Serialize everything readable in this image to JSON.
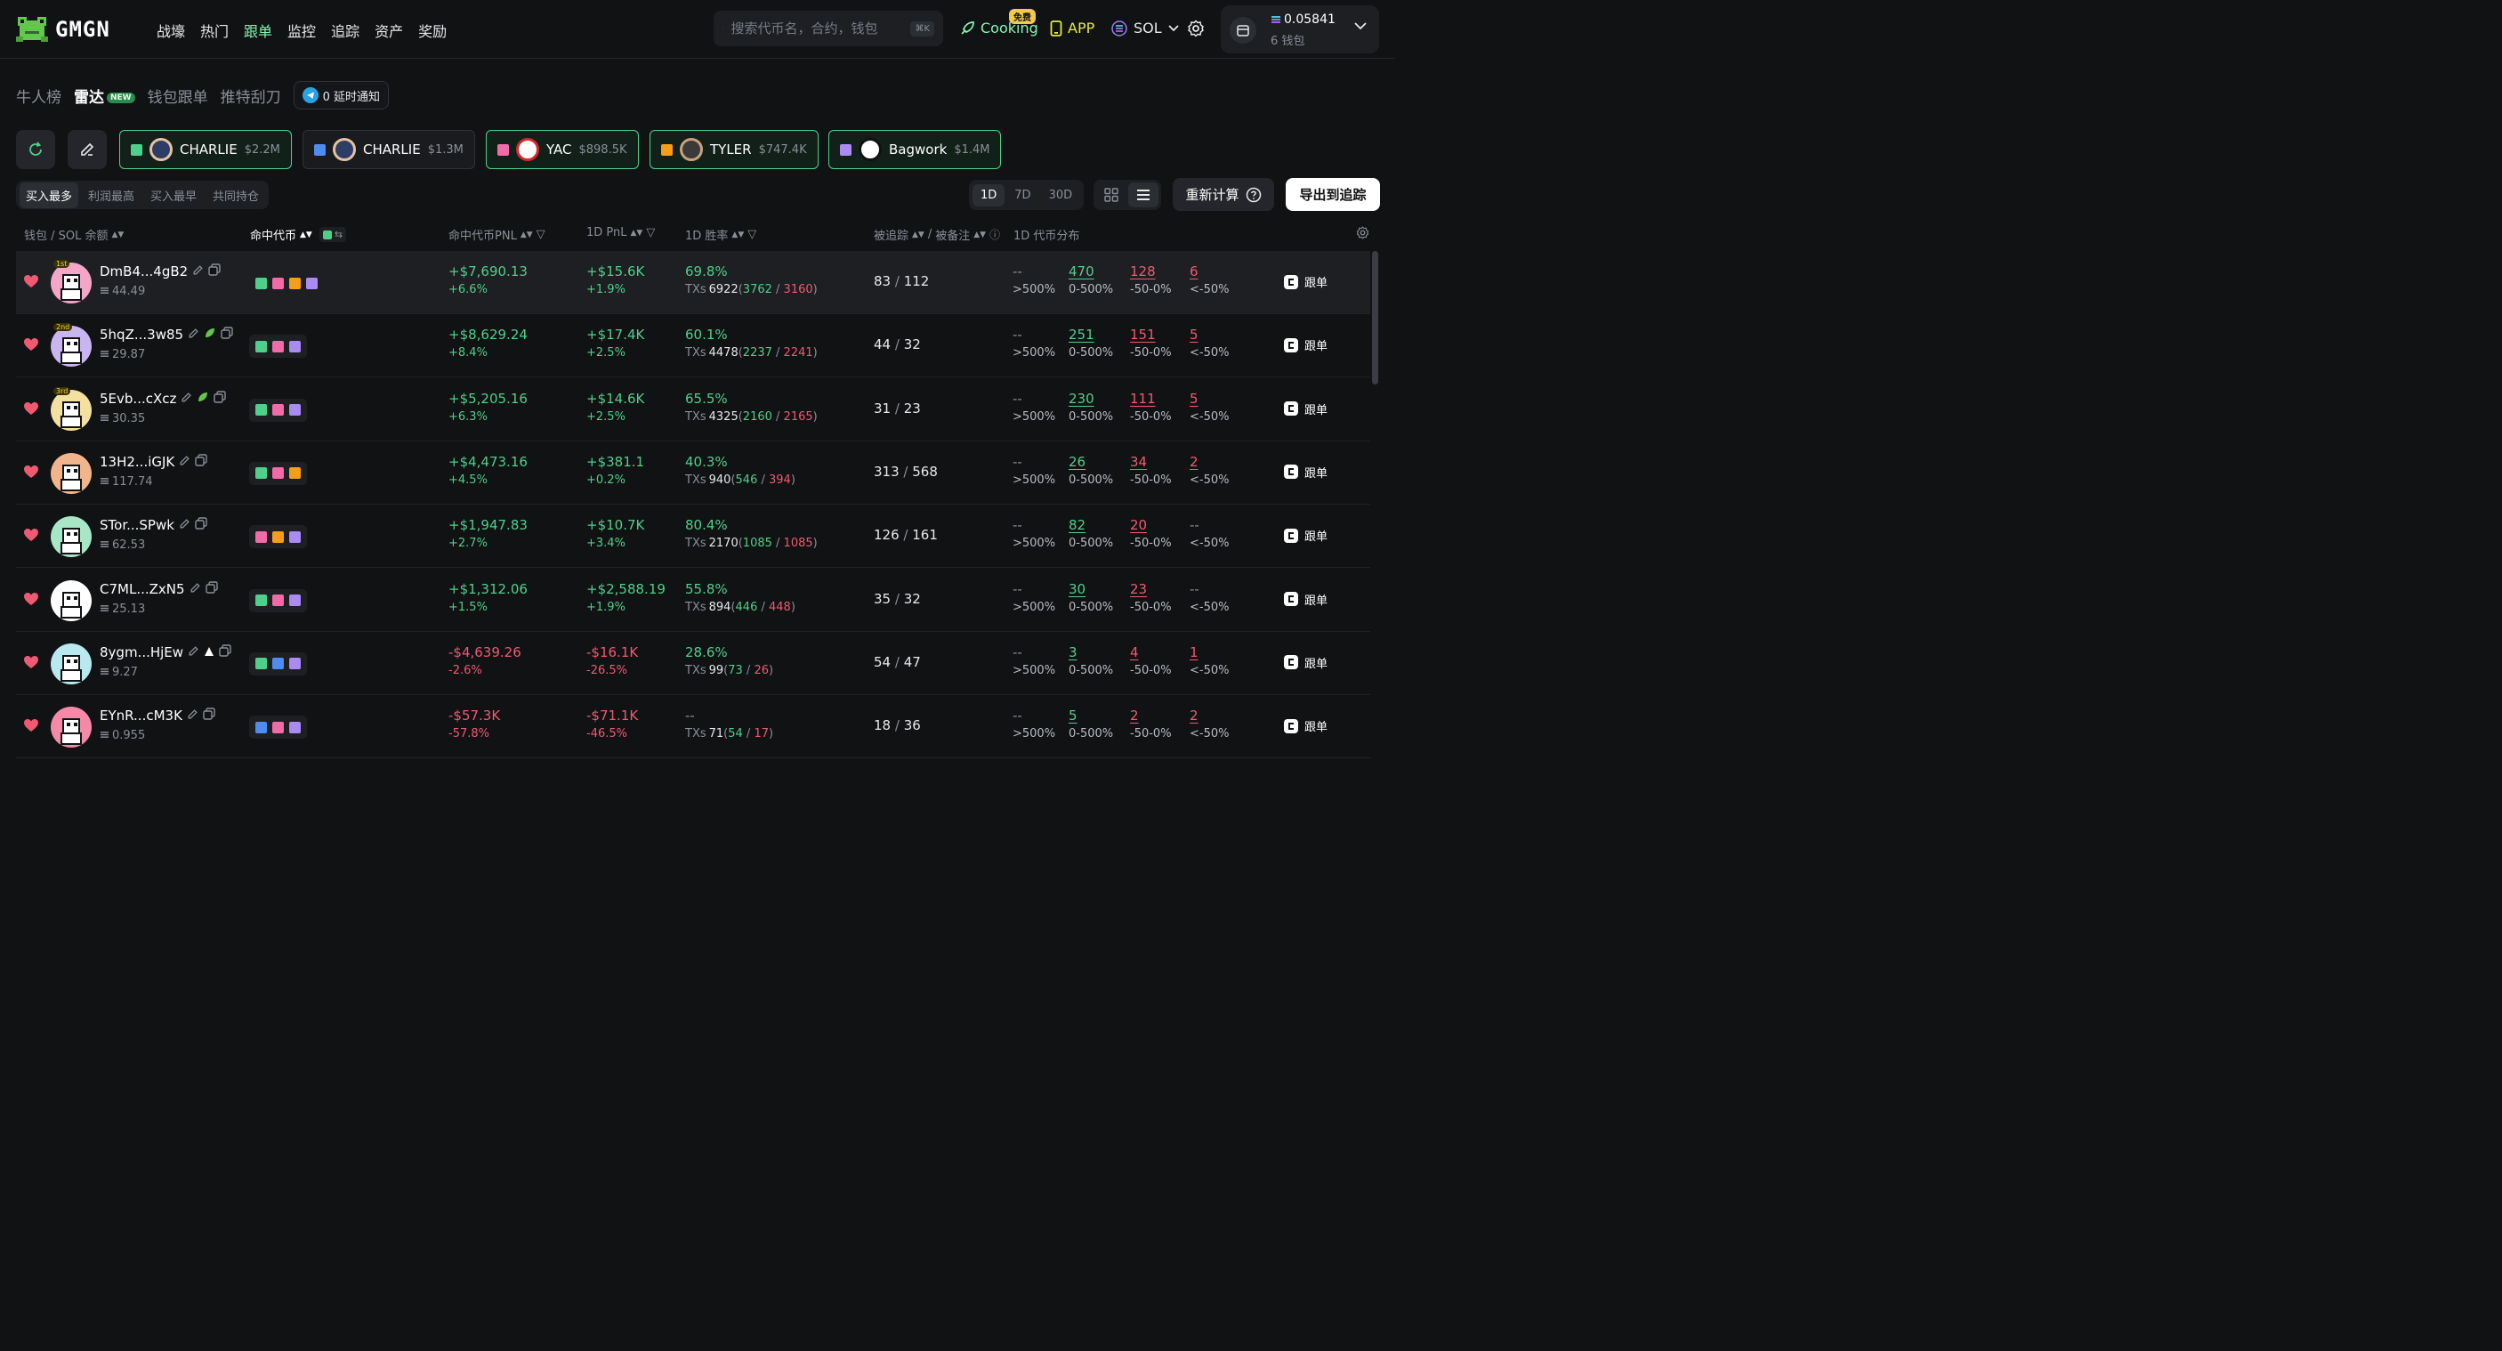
{
  "brand": {
    "name": "GMGN"
  },
  "nav": [
    "战壕",
    "热门",
    "跟单",
    "监控",
    "追踪",
    "资产",
    "奖励"
  ],
  "nav_active": 2,
  "search": {
    "placeholder": "搜索代币名，合约，钱包",
    "shortcut": "⌘K"
  },
  "cooking": {
    "label": "Cooking",
    "badge": "免费"
  },
  "app_label": "APP",
  "chain": "SOL",
  "wallet": {
    "balance": "0.05841",
    "count": "6 钱包"
  },
  "subtabs": [
    {
      "label": "牛人榜"
    },
    {
      "label": "雷达",
      "badge": "NEW"
    },
    {
      "label": "钱包跟单"
    },
    {
      "label": "推特刮刀"
    }
  ],
  "notify_label": "0 延时通知",
  "chips": [
    {
      "name": "CHARLIE",
      "amount": "$2.2M",
      "color": "#4fd08a",
      "selected": true
    },
    {
      "name": "CHARLIE",
      "amount": "$1.3M",
      "color": "#4f8cf0",
      "selected": false
    },
    {
      "name": "YAC",
      "amount": "$898.5K",
      "color": "#f06ba8",
      "selected": true
    },
    {
      "name": "TYLER",
      "amount": "$747.4K",
      "color": "#f59e1b",
      "selected": true
    },
    {
      "name": "Bagwork",
      "amount": "$1.4M",
      "color": "#a98bf2",
      "selected": true
    }
  ],
  "sort_tabs": [
    "买入最多",
    "利润最高",
    "买入最早",
    "共同持仓"
  ],
  "periods": [
    "1D",
    "7D",
    "30D"
  ],
  "recalc_label": "重新计算",
  "export_label": "导出到追踪",
  "headers": {
    "wallet": "钱包 / SOL 余额",
    "hit": "命中代币",
    "hit_pnl": "命中代币PNL",
    "pnl1d": "1D PnL",
    "winrate": "1D 胜率",
    "tracked": "被追踪",
    "remarked": "被备注",
    "dist": "1D 代币分布"
  },
  "dist_labels": [
    ">500%",
    "0-500%",
    "-50-0%",
    "<-50%"
  ],
  "follow_label": "跟单",
  "txs_label": "TXs",
  "rows": [
    {
      "name": "DmB4...4gB2",
      "rank": "1st",
      "bal": "44.49",
      "tokens": [
        "#4fd08a",
        "#f06ba8",
        "#f59e1b",
        "#a98bf2"
      ],
      "pnl": "+$7,690.13",
      "pnl_pct": "+6.6%",
      "d1": "+$15.6K",
      "d1_pct": "+1.9%",
      "wr": "69.8%",
      "txs": "6922",
      "buy": "3762",
      "sell": "3160",
      "tracked": "83",
      "remarked": "112",
      "dist": [
        "--",
        "470",
        "128",
        "6"
      ],
      "tag": "",
      "up": true
    },
    {
      "name": "5hqZ...3w85",
      "rank": "2nd",
      "bal": "29.87",
      "tokens": [
        "#4fd08a",
        "#f06ba8",
        "#a98bf2"
      ],
      "pnl": "+$8,629.24",
      "pnl_pct": "+8.4%",
      "d1": "+$17.4K",
      "d1_pct": "+2.5%",
      "wr": "60.1%",
      "txs": "4478",
      "buy": "2237",
      "sell": "2241",
      "tracked": "44",
      "remarked": "32",
      "dist": [
        "--",
        "251",
        "151",
        "5"
      ],
      "tag": "leaf",
      "up": true
    },
    {
      "name": "5Evb...cXcz",
      "rank": "3rd",
      "bal": "30.35",
      "tokens": [
        "#4fd08a",
        "#f06ba8",
        "#a98bf2"
      ],
      "pnl": "+$5,205.16",
      "pnl_pct": "+6.3%",
      "d1": "+$14.6K",
      "d1_pct": "+2.5%",
      "wr": "65.5%",
      "txs": "4325",
      "buy": "2160",
      "sell": "2165",
      "tracked": "31",
      "remarked": "23",
      "dist": [
        "--",
        "230",
        "111",
        "5"
      ],
      "tag": "leaf",
      "up": true
    },
    {
      "name": "13H2...iGJK",
      "rank": "",
      "bal": "117.74",
      "tokens": [
        "#4fd08a",
        "#f06ba8",
        "#f59e1b"
      ],
      "pnl": "+$4,473.16",
      "pnl_pct": "+4.5%",
      "d1": "+$381.1",
      "d1_pct": "+0.2%",
      "wr": "40.3%",
      "txs": "940",
      "buy": "546",
      "sell": "394",
      "tracked": "313",
      "remarked": "568",
      "dist": [
        "--",
        "26",
        "34",
        "2"
      ],
      "tag": "",
      "up": true
    },
    {
      "name": "STor...SPwk",
      "rank": "",
      "bal": "62.53",
      "tokens": [
        "#f06ba8",
        "#f59e1b",
        "#a98bf2"
      ],
      "pnl": "+$1,947.83",
      "pnl_pct": "+2.7%",
      "d1": "+$10.7K",
      "d1_pct": "+3.4%",
      "wr": "80.4%",
      "txs": "2170",
      "buy": "1085",
      "sell": "1085",
      "tracked": "126",
      "remarked": "161",
      "dist": [
        "--",
        "82",
        "20",
        "--"
      ],
      "tag": "",
      "up": true
    },
    {
      "name": "C7ML...ZxN5",
      "rank": "",
      "bal": "25.13",
      "tokens": [
        "#4fd08a",
        "#f06ba8",
        "#a98bf2"
      ],
      "pnl": "+$1,312.06",
      "pnl_pct": "+1.5%",
      "d1": "+$2,588.19",
      "d1_pct": "+1.9%",
      "wr": "55.8%",
      "txs": "894",
      "buy": "446",
      "sell": "448",
      "tracked": "35",
      "remarked": "32",
      "dist": [
        "--",
        "30",
        "23",
        "--"
      ],
      "tag": "",
      "up": true
    },
    {
      "name": "8ygm...HjEw",
      "rank": "",
      "bal": "9.27",
      "tokens": [
        "#4fd08a",
        "#4f8cf0",
        "#a98bf2"
      ],
      "pnl": "-$4,639.26",
      "pnl_pct": "-2.6%",
      "d1": "-$16.1K",
      "d1_pct": "-26.5%",
      "wr": "28.6%",
      "txs": "99",
      "buy": "73",
      "sell": "26",
      "tracked": "54",
      "remarked": "47",
      "dist": [
        "--",
        "3",
        "4",
        "1"
      ],
      "tag": "hat",
      "up": false
    },
    {
      "name": "EYnR...cM3K",
      "rank": "",
      "bal": "0.955",
      "tokens": [
        "#4f8cf0",
        "#f06ba8",
        "#a98bf2"
      ],
      "pnl": "-$57.3K",
      "pnl_pct": "-57.8%",
      "d1": "-$71.1K",
      "d1_pct": "-46.5%",
      "wr": "--",
      "txs": "71",
      "buy": "54",
      "sell": "17",
      "tracked": "18",
      "remarked": "36",
      "dist": [
        "--",
        "5",
        "2",
        "2"
      ],
      "tag": "",
      "up": false
    }
  ]
}
